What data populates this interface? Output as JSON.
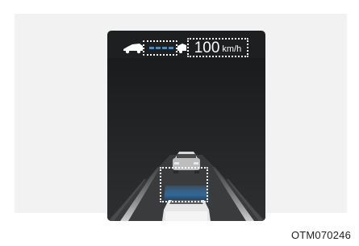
{
  "display": {
    "set_speed_value": "100",
    "set_speed_unit": "km/h",
    "gap_level_bars": 4,
    "highlight_color": "#3a8fd0"
  },
  "figure": {
    "code": "OTM070246"
  }
}
